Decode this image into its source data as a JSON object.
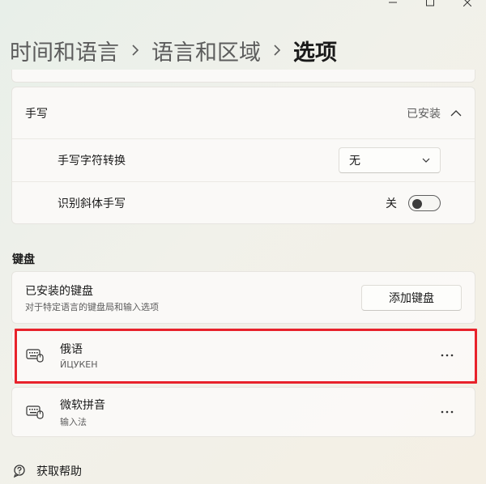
{
  "window": {
    "controls": [
      "minimize-icon",
      "maximize-icon",
      "close-icon"
    ]
  },
  "breadcrumb": {
    "item1": "时间和语言",
    "item2": "语言和区域",
    "current": "选项"
  },
  "handwriting": {
    "title": "手写",
    "status": "已安装",
    "rows": [
      {
        "label": "手写字符转换",
        "value": "无"
      },
      {
        "label": "识别斜体手写",
        "toggle_state": "关"
      }
    ]
  },
  "keyboard_section": {
    "title": "键盘",
    "installed_title": "已安装的键盘",
    "installed_subtitle": "对于特定语言的键盘局和输入选项",
    "add_button": "添加键盘",
    "keyboards": [
      {
        "name": "俄语",
        "layout": "ЙЦУКЕН",
        "icon": "keyboard-icon",
        "more": "···"
      },
      {
        "name": "微软拼音",
        "layout": "输入法",
        "icon": "keyboard-icon",
        "more": "···"
      }
    ]
  },
  "help": {
    "label": "获取帮助",
    "icon": "help-icon"
  },
  "colors": {
    "highlight": "#e8222b"
  }
}
